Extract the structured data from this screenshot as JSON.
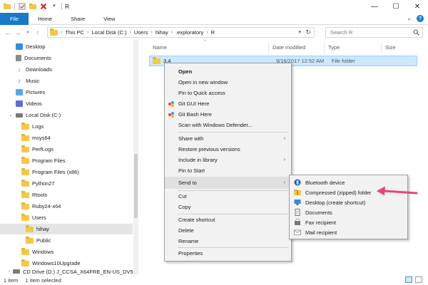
{
  "window": {
    "title": "R",
    "controls": {
      "minimize": "—",
      "maximize": "☐",
      "close": "✕"
    }
  },
  "ribbon": {
    "tabs": [
      "File",
      "Home",
      "Share",
      "View"
    ],
    "help": "?"
  },
  "address": {
    "crumbs": [
      "This PC",
      "Local Disk (C:)",
      "Users",
      "hihay",
      ".exploratory",
      "R"
    ],
    "search_placeholder": "Search R"
  },
  "nav_pane": {
    "items": [
      {
        "label": "Desktop",
        "icon": "desktop-icon",
        "color": "#2f8ee0",
        "indent": 0
      },
      {
        "label": "Documents",
        "icon": "documents-icon",
        "color": "#8c8c8c",
        "indent": 0
      },
      {
        "label": "Downloads",
        "icon": "downloads-icon",
        "color": "#2f8ee0",
        "indent": 0
      },
      {
        "label": "Music",
        "icon": "music-icon",
        "color": "#2f8ee0",
        "indent": 0
      },
      {
        "label": "Pictures",
        "icon": "pictures-icon",
        "color": "#5aa5e6",
        "indent": 0
      },
      {
        "label": "Videos",
        "icon": "videos-icon",
        "color": "#5a6fd6",
        "indent": 0
      },
      {
        "label": "Local Disk (C:)",
        "icon": "drive-icon",
        "color": "#7a7a7a",
        "indent": 0,
        "expanded": true
      },
      {
        "label": "Logs",
        "icon": "folder-icon",
        "indent": 1
      },
      {
        "label": "msys64",
        "icon": "folder-icon",
        "indent": 1
      },
      {
        "label": "PerfLogs",
        "icon": "folder-icon",
        "indent": 1
      },
      {
        "label": "Program Files",
        "icon": "folder-icon",
        "indent": 1
      },
      {
        "label": "Program Files (x86)",
        "icon": "folder-icon",
        "indent": 1
      },
      {
        "label": "Python27",
        "icon": "folder-icon",
        "indent": 1
      },
      {
        "label": "Rtools",
        "icon": "folder-icon",
        "indent": 1
      },
      {
        "label": "Ruby24-x64",
        "icon": "folder-icon",
        "indent": 1
      },
      {
        "label": "Users",
        "icon": "folder-icon",
        "indent": 1
      },
      {
        "label": "hihay",
        "icon": "folder-icon",
        "indent": 2,
        "selected": true
      },
      {
        "label": "Public",
        "icon": "folder-icon",
        "indent": 2
      },
      {
        "label": "Windows",
        "icon": "folder-icon",
        "indent": 1
      },
      {
        "label": "Windows10Upgrade",
        "icon": "folder-icon",
        "indent": 1
      },
      {
        "label": "CD Drive (D:) J_CCSA_X64FRE_EN-US_DV5",
        "icon": "cd-drive-icon",
        "color": "#7a7a7a",
        "indent": 0
      }
    ]
  },
  "content": {
    "columns": [
      "Name",
      "Date modified",
      "Type",
      "Size"
    ],
    "rows": [
      {
        "name": "3.4",
        "date": "9/16/2017 12:52 AM",
        "type": "File folder",
        "size": ""
      }
    ]
  },
  "context_menu": {
    "items": [
      {
        "label": "Open",
        "bold": true
      },
      {
        "label": "Open in new window"
      },
      {
        "label": "Pin to Quick access"
      },
      {
        "label": "Git GUI Here",
        "icon": "git-icon"
      },
      {
        "label": "Git Bash Here",
        "icon": "git-icon"
      },
      {
        "label": "Scan with Windows Defender...",
        "icon": "defender-icon"
      },
      {
        "sep": true
      },
      {
        "label": "Share with",
        "submenu": true
      },
      {
        "label": "Restore previous versions"
      },
      {
        "label": "Include in library",
        "submenu": true
      },
      {
        "label": "Pin to Start"
      },
      {
        "sep": true
      },
      {
        "label": "Send to",
        "submenu": true,
        "highlighted": true
      },
      {
        "sep": true
      },
      {
        "label": "Cut"
      },
      {
        "label": "Copy"
      },
      {
        "sep": true
      },
      {
        "label": "Create shortcut"
      },
      {
        "label": "Delete"
      },
      {
        "label": "Rename"
      },
      {
        "sep": true
      },
      {
        "label": "Properties"
      }
    ]
  },
  "send_to_menu": {
    "items": [
      {
        "label": "Bluetooth device",
        "icon": "bluetooth-icon"
      },
      {
        "label": "Compressed (zipped) folder",
        "icon": "zip-folder-icon"
      },
      {
        "label": "Desktop (create shortcut)",
        "icon": "desktop-icon"
      },
      {
        "label": "Documents",
        "icon": "documents-icon"
      },
      {
        "label": "Fax recipient",
        "icon": "fax-icon"
      },
      {
        "label": "Mail recipient",
        "icon": "mail-icon"
      }
    ]
  },
  "status_bar": {
    "item_count": "1 item",
    "selected": "1 item selected"
  },
  "colors": {
    "accent": "#1979ca",
    "selection": "#cce8ff",
    "annotation_arrow": "#e8457a"
  }
}
